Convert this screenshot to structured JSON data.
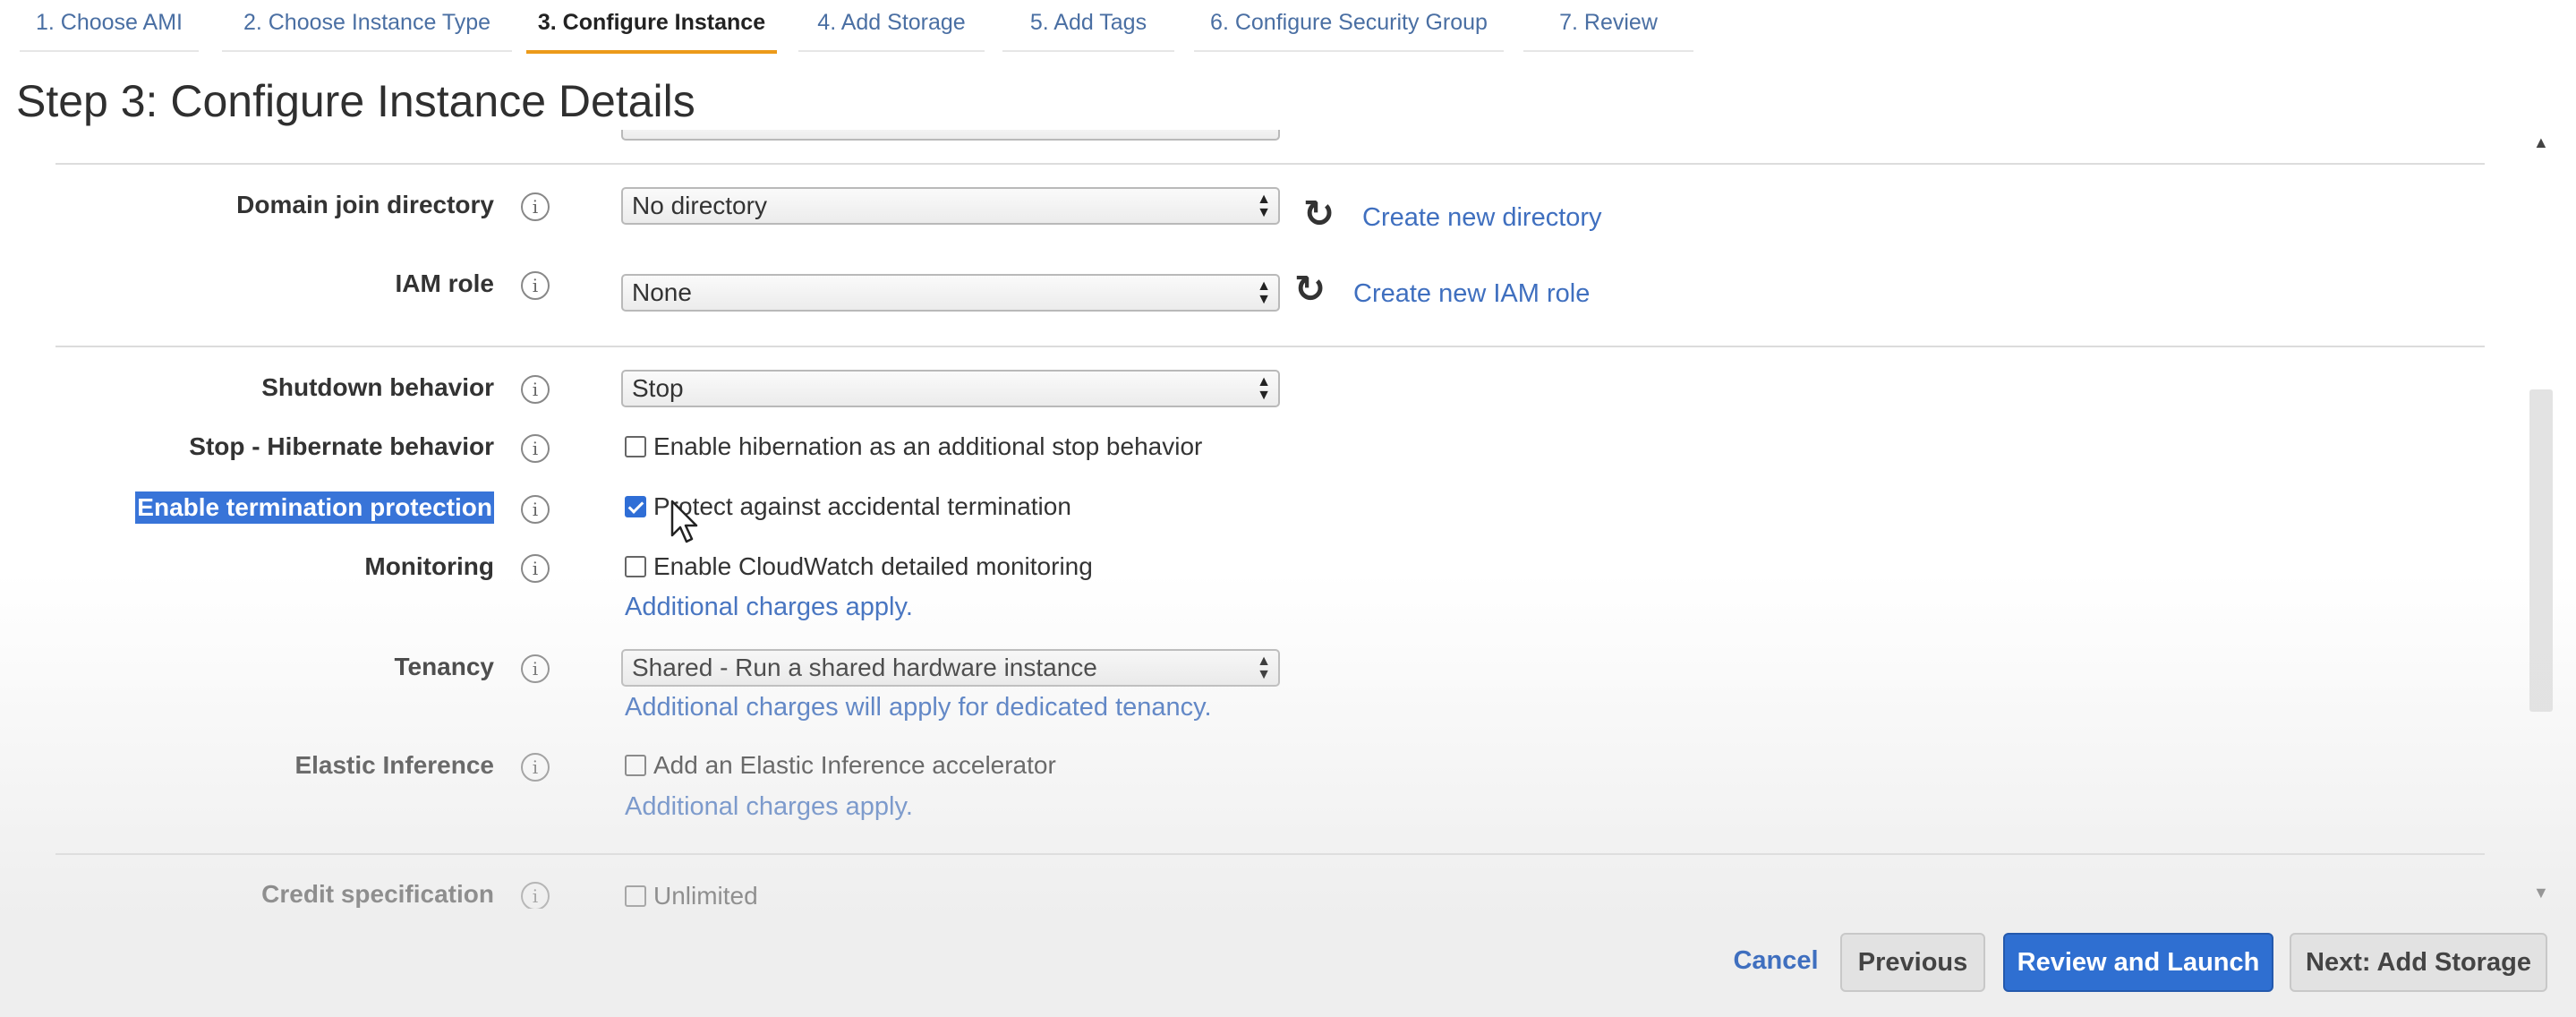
{
  "wizard": {
    "tabs": [
      {
        "label": "1. Choose AMI"
      },
      {
        "label": "2. Choose Instance Type"
      },
      {
        "label": "3. Configure Instance"
      },
      {
        "label": "4. Add Storage"
      },
      {
        "label": "5. Add Tags"
      },
      {
        "label": "6. Configure Security Group"
      },
      {
        "label": "7. Review"
      }
    ],
    "active_tab": "3. Configure Instance"
  },
  "page": {
    "title": "Step 3: Configure Instance Details"
  },
  "form": {
    "domain_join": {
      "label": "Domain join directory",
      "value": "No directory",
      "link": "Create new directory"
    },
    "iam_role": {
      "label": "IAM role",
      "value": "None",
      "link": "Create new IAM role"
    },
    "shutdown": {
      "label": "Shutdown behavior",
      "value": "Stop"
    },
    "hibernate": {
      "label": "Stop - Hibernate behavior",
      "checkbox_label": "Enable hibernation as an additional stop behavior",
      "checked": false
    },
    "termination": {
      "label": "Enable termination protection",
      "checkbox_label": "Protect against accidental termination",
      "checked": true
    },
    "monitoring": {
      "label": "Monitoring",
      "checkbox_label": "Enable CloudWatch detailed monitoring",
      "checked": false,
      "note": "Additional charges apply."
    },
    "tenancy": {
      "label": "Tenancy",
      "value": "Shared - Run a shared hardware instance",
      "note": "Additional charges will apply for dedicated tenancy."
    },
    "elastic_inference": {
      "label": "Elastic Inference",
      "checkbox_label": "Add an Elastic Inference accelerator",
      "checked": false,
      "note": "Additional charges apply."
    },
    "credit": {
      "label": "Credit specification",
      "checkbox_label": "Unlimited",
      "checked": false
    }
  },
  "icons": {
    "info": "i",
    "refresh": "refresh-icon"
  },
  "footer": {
    "cancel": "Cancel",
    "previous": "Previous",
    "review_launch": "Review and Launch",
    "next": "Next: Add Storage"
  },
  "colors": {
    "accent": "#ec9a1a",
    "primary": "#2f6fd1",
    "link": "#3f6fbf",
    "highlight": "#3874d8"
  }
}
